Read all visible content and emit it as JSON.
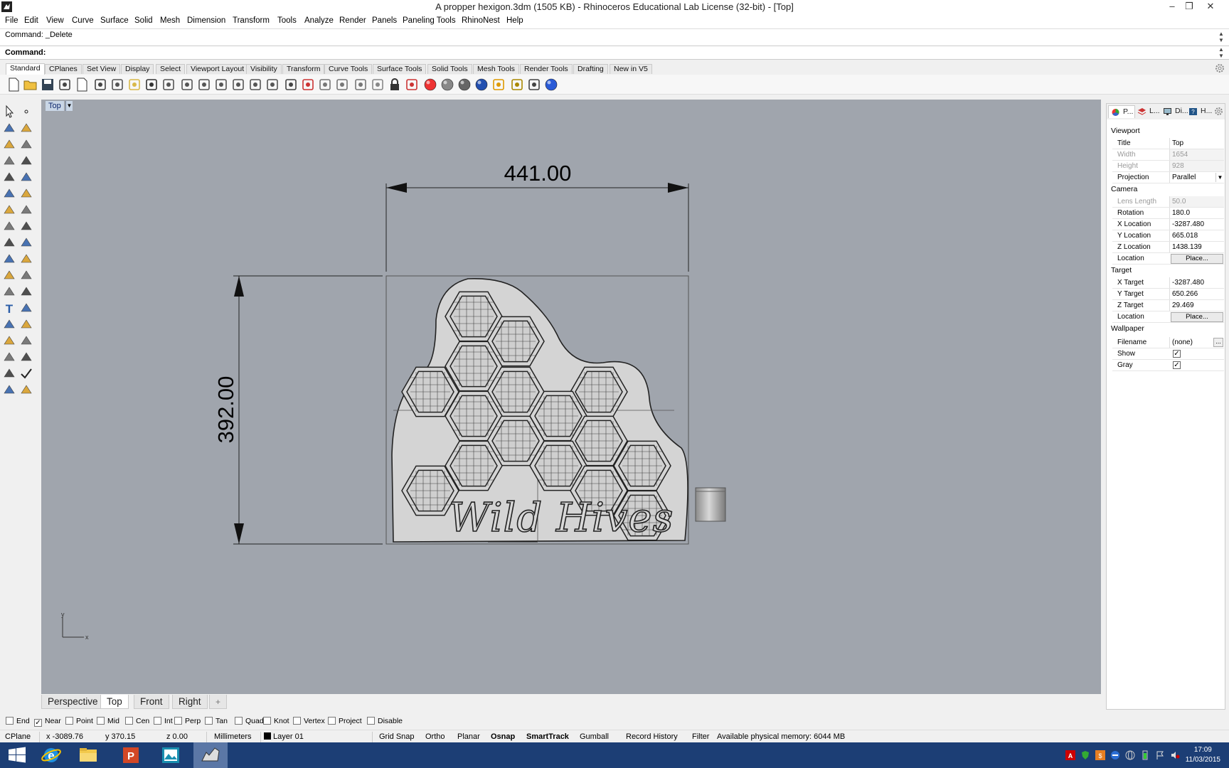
{
  "window": {
    "title": "A propper hexigon.3dm (1505 KB) - Rhinoceros Educational Lab License (32-bit) - [Top]"
  },
  "menu": [
    "File",
    "Edit",
    "View",
    "Curve",
    "Surface",
    "Solid",
    "Mesh",
    "Dimension",
    "Transform",
    "Tools",
    "Analyze",
    "Render",
    "Panels",
    "Paneling Tools",
    "RhinoNest",
    "Help"
  ],
  "command": {
    "history": "Command: _Delete",
    "prompt": "Command:",
    "value": ""
  },
  "toolbar_tabs": [
    "Standard",
    "CPlanes",
    "Set View",
    "Display",
    "Select",
    "Viewport Layout",
    "Visibility",
    "Transform",
    "Curve Tools",
    "Surface Tools",
    "Solid Tools",
    "Mesh Tools",
    "Render Tools",
    "Drafting",
    "New in V5"
  ],
  "toolbar_icons": [
    "new-file-icon",
    "open-file-icon",
    "save-icon",
    "print-icon",
    "import-icon",
    "cut-icon",
    "copy-icon",
    "paste-icon",
    "undo-icon",
    "pan-icon",
    "move-icon",
    "zoom-icon",
    "zoom-window-icon",
    "zoom-extents-icon",
    "zoom-selected-icon",
    "rotate-view-icon",
    "four-viewports-icon",
    "car-icon",
    "plane-icon",
    "circle-icon",
    "grid-icon",
    "light-icon",
    "lock-icon",
    "material-icon",
    "color-wheel-icon",
    "sphere-gray-icon",
    "sphere-shaded-icon",
    "sphere-render-icon",
    "flag-icon",
    "gear-cluster-icon",
    "dimension-icon",
    "help-icon"
  ],
  "viewport": {
    "title": "Top",
    "dim_horizontal": "441.00",
    "dim_vertical": "392.00",
    "model_text": "Wild Hives",
    "axis_x": "x",
    "axis_y": "y"
  },
  "viewport_tabs": [
    "Perspective",
    "Top",
    "Front",
    "Right"
  ],
  "active_viewport_tab": "Top",
  "osnaps": [
    {
      "label": "End",
      "checked": false
    },
    {
      "label": "Near",
      "checked": true
    },
    {
      "label": "Point",
      "checked": false
    },
    {
      "label": "Mid",
      "checked": false
    },
    {
      "label": "Cen",
      "checked": false
    },
    {
      "label": "Int",
      "checked": false
    },
    {
      "label": "Perp",
      "checked": false
    },
    {
      "label": "Tan",
      "checked": false
    },
    {
      "label": "Quad",
      "checked": false
    },
    {
      "label": "Knot",
      "checked": false
    },
    {
      "label": "Vertex",
      "checked": false
    },
    {
      "label": "Project",
      "checked": false
    },
    {
      "label": "Disable",
      "checked": false
    }
  ],
  "status": {
    "cplane": "CPlane",
    "x": "x -3089.76",
    "y": "y 370.15",
    "z": "z 0.00",
    "units": "Millimeters",
    "layer": "Layer 01",
    "grid_snap": "Grid Snap",
    "ortho": "Ortho",
    "planar": "Planar",
    "osnap": "Osnap",
    "smarttrack": "SmartTrack",
    "gumball": "Gumball",
    "record_history": "Record History",
    "filter": "Filter",
    "memory": "Available physical memory: 6044 MB"
  },
  "panel": {
    "tabs": [
      "P...",
      "L...",
      "Di...",
      "H..."
    ],
    "sections": {
      "viewport": "Viewport",
      "camera": "Camera",
      "target": "Target",
      "wallpaper": "Wallpaper"
    },
    "viewport_rows": {
      "title": {
        "label": "Title",
        "value": "Top"
      },
      "width": {
        "label": "Width",
        "value": "1654"
      },
      "height": {
        "label": "Height",
        "value": "928"
      },
      "projection": {
        "label": "Projection",
        "value": "Parallel"
      }
    },
    "camera_rows": {
      "lens": {
        "label": "Lens Length",
        "value": "50.0"
      },
      "rotation": {
        "label": "Rotation",
        "value": "180.0"
      },
      "xloc": {
        "label": "X Location",
        "value": "-3287.480"
      },
      "yloc": {
        "label": "Y Location",
        "value": "665.018"
      },
      "zloc": {
        "label": "Z Location",
        "value": "1438.139"
      },
      "location": {
        "label": "Location",
        "button": "Place..."
      }
    },
    "target_rows": {
      "xt": {
        "label": "X Target",
        "value": "-3287.480"
      },
      "yt": {
        "label": "Y Target",
        "value": "650.266"
      },
      "zt": {
        "label": "Z Target",
        "value": "29.469"
      },
      "location": {
        "label": "Location",
        "button": "Place..."
      }
    },
    "wallpaper_rows": {
      "filename": {
        "label": "Filename",
        "value": "(none)",
        "button": "..."
      },
      "show": {
        "label": "Show",
        "checked": true
      },
      "gray": {
        "label": "Gray",
        "checked": true
      }
    }
  },
  "taskbar": {
    "apps": [
      "start-icon",
      "internet-explorer-icon",
      "file-explorer-icon",
      "powerpoint-icon",
      "photos-icon",
      "rhino-icon"
    ],
    "time": "17:09",
    "date": "11/03/2015"
  },
  "colors": {
    "viewport_bg": "#a0a5ad",
    "model_fill": "#d4d4d4",
    "taskbar": "#1c3e75",
    "viewport_label": "#c9d6e6"
  }
}
